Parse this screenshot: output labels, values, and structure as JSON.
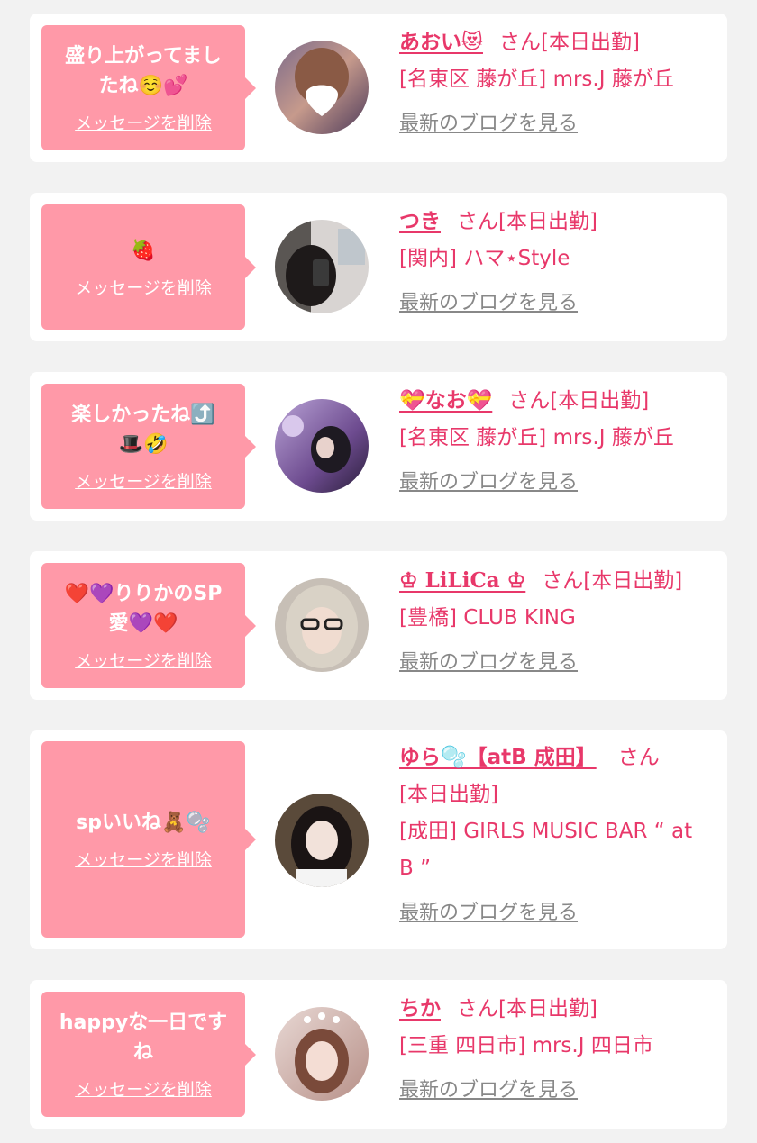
{
  "colors": {
    "background": "#f2f2f2",
    "card": "#ffffff",
    "bubble": "#ff99a8",
    "accent": "#e8386a",
    "link_gray": "#888888"
  },
  "messages": [
    {
      "bubble_line1": "盛り上がってまし",
      "bubble_line2": "たね☺️💕",
      "delete_label": "メッセージを削除",
      "cast_name": "あおい😻",
      "san": "さん",
      "status": "[本日出勤]",
      "shop": "[名東区 藤が丘] mrs.J 藤が丘",
      "blog_label": "最新のブログを見る"
    },
    {
      "bubble_line1": "🍓",
      "bubble_line2": "",
      "delete_label": "メッセージを削除",
      "cast_name": "つき",
      "san": "さん",
      "status": "[本日出勤]",
      "shop": "[関内] ハマ⋆Style",
      "blog_label": "最新のブログを見る"
    },
    {
      "bubble_line1": "楽しかったね⤴️",
      "bubble_line2": "🎩🤣",
      "delete_label": "メッセージを削除",
      "cast_name": "💝なお💝",
      "san": "さん",
      "status": "[本日出勤]",
      "shop": "[名東区 藤が丘] mrs.J 藤が丘",
      "blog_label": "最新のブログを見る"
    },
    {
      "bubble_line1": "❤️💜りりかのSP",
      "bubble_line2": "愛💜❤️",
      "delete_label": "メッセージを削除",
      "cast_name": "♔ LiLiCa ♔",
      "san": "さん",
      "status": "[本日出勤]",
      "shop": "[豊橋] CLUB KING",
      "blog_label": "最新のブログを見る"
    },
    {
      "bubble_line1": "spいいね🧸🫧",
      "bubble_line2": "",
      "delete_label": "メッセージを削除",
      "cast_name": "ゆら🫧【atB 成田】",
      "san": "さん",
      "status": "[本日出勤]",
      "shop": "[成田] GIRLS MUSIC BAR “ at B ”",
      "blog_label": "最新のブログを見る"
    },
    {
      "bubble_line1": "happyな一日です",
      "bubble_line2": "ね",
      "delete_label": "メッセージを削除",
      "cast_name": "ちか",
      "san": "さん",
      "status": "[本日出勤]",
      "shop": "[三重 四日市] mrs.J 四日市",
      "blog_label": "最新のブログを見る"
    }
  ]
}
